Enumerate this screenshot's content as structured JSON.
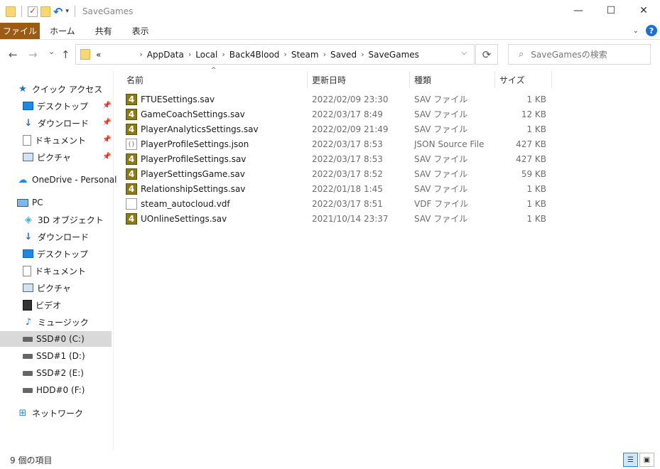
{
  "window": {
    "title": "SaveGames",
    "controls": {
      "minimize": "—",
      "maximize": "☐",
      "close": "✕"
    }
  },
  "ribbon": {
    "tabs": [
      {
        "label": "ファイル"
      },
      {
        "label": "ホーム"
      },
      {
        "label": "共有"
      },
      {
        "label": "表示"
      }
    ],
    "help_label": "?"
  },
  "navigation": {
    "back": "←",
    "forward": "→",
    "recent": "⌄",
    "up": "↑",
    "overflow": "«",
    "breadcrumbs": [
      "AppData",
      "Local",
      "Back4Blood",
      "Steam",
      "Saved",
      "SaveGames"
    ],
    "separator": "›",
    "refresh": "⟳",
    "search_placeholder": "SaveGamesの検索"
  },
  "sidebar": {
    "quick_access": "クイック アクセス",
    "quick_items": [
      {
        "label": "デスクトップ",
        "icon": "desktop-icon"
      },
      {
        "label": "ダウンロード",
        "icon": "download-icon"
      },
      {
        "label": "ドキュメント",
        "icon": "document-icon"
      },
      {
        "label": "ピクチャ",
        "icon": "pictures-icon"
      }
    ],
    "onedrive": "OneDrive - Personal",
    "pc": "PC",
    "pc_items": [
      {
        "label": "3D オブジェクト",
        "icon": "3d-objects-icon"
      },
      {
        "label": "ダウンロード",
        "icon": "download-icon"
      },
      {
        "label": "デスクトップ",
        "icon": "desktop-icon"
      },
      {
        "label": "ドキュメント",
        "icon": "document-icon"
      },
      {
        "label": "ピクチャ",
        "icon": "pictures-icon"
      },
      {
        "label": "ビデオ",
        "icon": "video-icon"
      },
      {
        "label": "ミュージック",
        "icon": "music-icon"
      },
      {
        "label": "SSD#0 (C:)",
        "icon": "drive-icon",
        "selected": true
      },
      {
        "label": "SSD#1 (D:)",
        "icon": "drive-icon"
      },
      {
        "label": "SSD#2 (E:)",
        "icon": "drive-icon"
      },
      {
        "label": "HDD#0 (F:)",
        "icon": "drive-icon"
      }
    ],
    "network": "ネットワーク"
  },
  "columns": {
    "name": "名前",
    "date": "更新日時",
    "type": "種類",
    "size": "サイズ"
  },
  "files": [
    {
      "name": "FTUESettings.sav",
      "date": "2022/02/09 23:30",
      "type": "SAV ファイル",
      "size": "1 KB",
      "icon": "sav-icon"
    },
    {
      "name": "GameCoachSettings.sav",
      "date": "2022/03/17 8:49",
      "type": "SAV ファイル",
      "size": "12 KB",
      "icon": "sav-icon"
    },
    {
      "name": "PlayerAnalyticsSettings.sav",
      "date": "2022/02/09 21:49",
      "type": "SAV ファイル",
      "size": "1 KB",
      "icon": "sav-icon"
    },
    {
      "name": "PlayerProfileSettings.json",
      "date": "2022/03/17 8:53",
      "type": "JSON Source File",
      "size": "427 KB",
      "icon": "json-file-icon"
    },
    {
      "name": "PlayerProfileSettings.sav",
      "date": "2022/03/17 8:53",
      "type": "SAV ファイル",
      "size": "427 KB",
      "icon": "sav-icon"
    },
    {
      "name": "PlayerSettingsGame.sav",
      "date": "2022/03/17 8:52",
      "type": "SAV ファイル",
      "size": "59 KB",
      "icon": "sav-icon"
    },
    {
      "name": "RelationshipSettings.sav",
      "date": "2022/01/18 1:45",
      "type": "SAV ファイル",
      "size": "1 KB",
      "icon": "sav-icon"
    },
    {
      "name": "steam_autocloud.vdf",
      "date": "2022/03/17 8:51",
      "type": "VDF ファイル",
      "size": "1 KB",
      "icon": "vdf-file-icon"
    },
    {
      "name": "UOnlineSettings.sav",
      "date": "2021/10/14 23:37",
      "type": "SAV ファイル",
      "size": "1 KB",
      "icon": "sav-icon"
    }
  ],
  "status": {
    "item_count": "9 個の項目"
  },
  "colors": {
    "file_tab": "#9c5b13",
    "accent": "#1e6fd9",
    "selected_bg": "#d9d9d9"
  }
}
